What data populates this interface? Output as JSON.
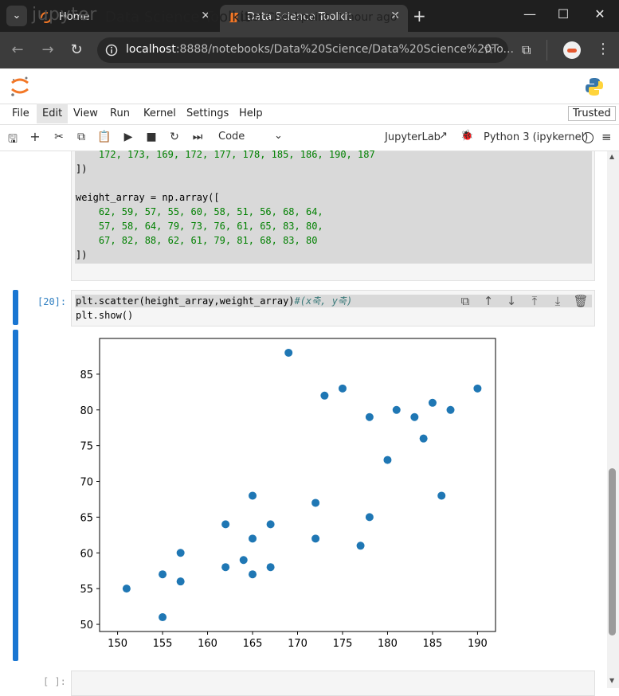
{
  "browser": {
    "tabs": [
      {
        "label": "Home"
      },
      {
        "label": "Data Science Toolkit"
      }
    ],
    "url_host": "localhost",
    "url_rest": ":8888/notebooks/Data%20Science/Data%20Science%20To..."
  },
  "jupyter": {
    "logo_text": "jupyter",
    "notebook_title": "Data Science Toolkit",
    "checkpoint": "Last Checkpoint: 1 hour ago",
    "menu": [
      "File",
      "Edit",
      "View",
      "Run",
      "Kernel",
      "Settings",
      "Help"
    ],
    "trusted": "Trusted",
    "cell_type": "Code",
    "jupyterlab_label": "JupyterLab",
    "kernel_name": "Python 3 (ipykernel)"
  },
  "cells": {
    "prev_cell_lines": [
      "    172, 173, 169, 172, 177, 178, 185, 186, 190, 187",
      "])",
      "",
      "weight_array = np.array([",
      "    62, 59, 57, 55, 60, 58, 51, 56, 68, 64,",
      "    57, 58, 64, 79, 73, 76, 61, 65, 83, 80,",
      "    67, 82, 88, 62, 61, 79, 81, 68, 83, 80",
      "])"
    ],
    "cell20_prompt": "[20]:",
    "cell20_line1_code": "plt.scatter(height_array,weight_array)",
    "cell20_line1_comment": "#(x축, y축)",
    "cell20_line2": "plt.show()",
    "empty_prompt": "[ ]:"
  },
  "chart_data": {
    "type": "scatter",
    "title": "",
    "xlabel": "",
    "ylabel": "",
    "xlim": [
      148,
      192
    ],
    "ylim": [
      49,
      90
    ],
    "xticks": [
      150,
      155,
      160,
      165,
      170,
      175,
      180,
      185,
      190
    ],
    "yticks": [
      50,
      55,
      60,
      65,
      70,
      75,
      80,
      85
    ],
    "color": "#1f77b4",
    "grid": false,
    "points": [
      [
        151,
        55
      ],
      [
        155,
        57
      ],
      [
        155,
        51
      ],
      [
        157,
        60
      ],
      [
        157,
        56
      ],
      [
        162,
        64
      ],
      [
        162,
        58
      ],
      [
        164,
        59
      ],
      [
        165,
        68
      ],
      [
        165,
        62
      ],
      [
        165,
        57
      ],
      [
        167,
        64
      ],
      [
        167,
        58
      ],
      [
        169,
        88
      ],
      [
        172,
        67
      ],
      [
        172,
        62
      ],
      [
        173,
        82
      ],
      [
        175,
        83
      ],
      [
        177,
        61
      ],
      [
        178,
        79
      ],
      [
        178,
        65
      ],
      [
        180,
        73
      ],
      [
        181,
        80
      ],
      [
        183,
        79
      ],
      [
        184,
        76
      ],
      [
        185,
        81
      ],
      [
        186,
        68
      ],
      [
        187,
        80
      ],
      [
        190,
        83
      ]
    ]
  }
}
